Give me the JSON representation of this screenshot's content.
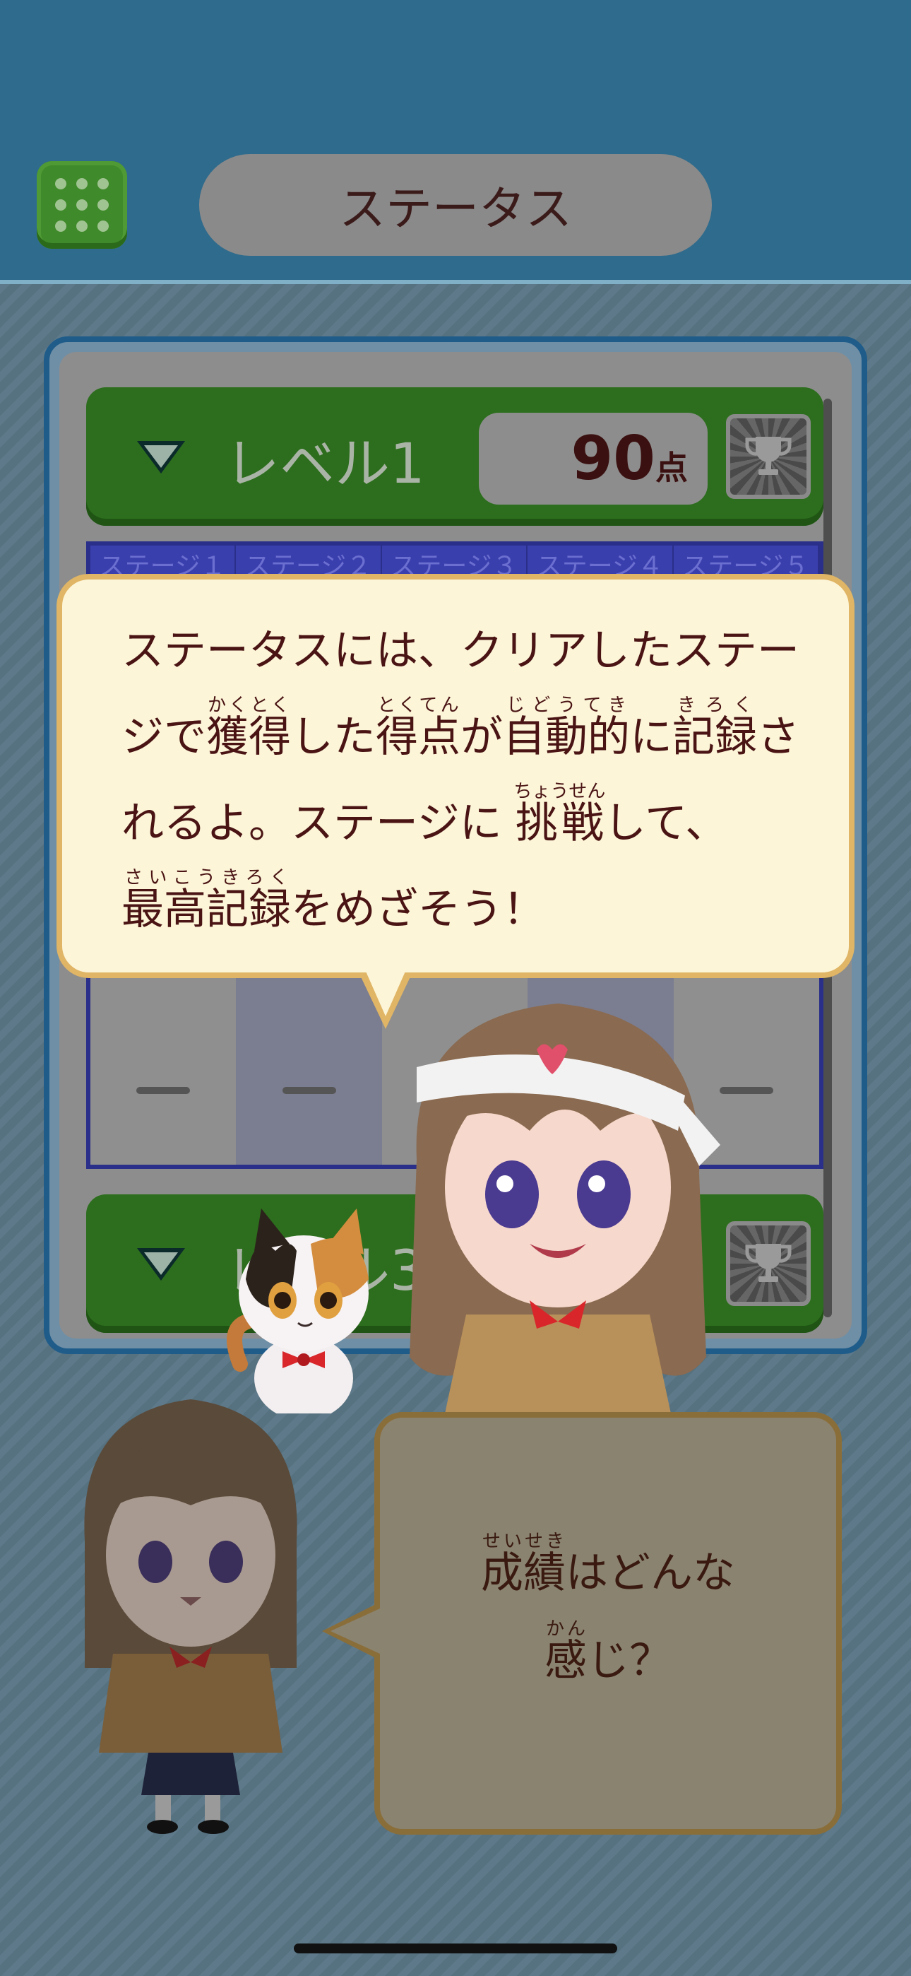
{
  "header": {
    "title": "ステータス",
    "menu_icon": "grid-menu-icon"
  },
  "status_panel": {
    "level1": {
      "label": "レベル1",
      "score": "90",
      "score_unit": "点",
      "trophy_icon": "trophy-icon"
    },
    "stage_headers": [
      "ステージ１",
      "ステージ２",
      "ステージ３",
      "ステージ４",
      "ステージ５"
    ],
    "stage_scores": [
      "ー",
      "ー",
      "ー",
      "ー",
      "ー"
    ],
    "level3": {
      "label": "レベル3",
      "trophy_icon": "trophy-icon"
    }
  },
  "guide_bubble": {
    "line1": "ステータスには、クリアしたステー",
    "line2": [
      {
        "t": "ジで"
      },
      {
        "t": "獲得",
        "r": "かくとく"
      },
      {
        "t": "した"
      },
      {
        "t": "得点",
        "r": "とくてん"
      },
      {
        "t": "が"
      },
      {
        "t": "自動的",
        "r": "じどうてき"
      },
      {
        "t": "に"
      },
      {
        "t": "記録",
        "r": "きろく"
      },
      {
        "t": "さ"
      }
    ],
    "line3": [
      {
        "t": "れるよ。ステージに "
      },
      {
        "t": "挑戦",
        "r": "ちょうせん"
      },
      {
        "t": "して、"
      }
    ],
    "line4": [
      {
        "t": "最高記録",
        "r": "さいこうきろく"
      },
      {
        "t": "をめざそう！"
      }
    ]
  },
  "question_bubble": {
    "line1": [
      {
        "t": "成績",
        "r": "せいせき"
      },
      {
        "t": "はどんな"
      }
    ],
    "line2": [
      {
        "t": "感",
        "r": "かん"
      },
      {
        "t": "じ？"
      }
    ]
  },
  "colors": {
    "header": "#2f6b8c",
    "level_bar": "#2c6e1d",
    "bubble_fill": "#fcf5d8",
    "bubble_border": "#e0b565"
  }
}
